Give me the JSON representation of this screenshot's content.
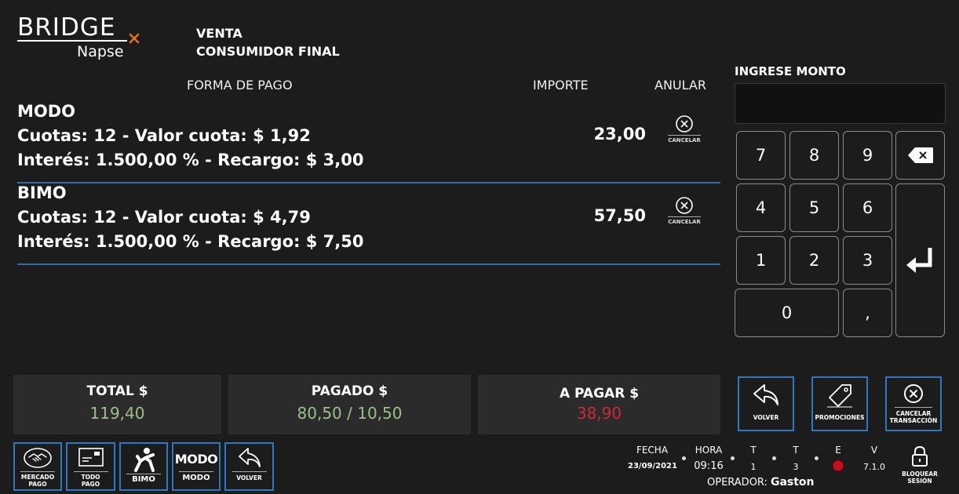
{
  "brand": {
    "name": "BRIDGE",
    "sub": "Napse",
    "accent": "#e8701a"
  },
  "header": {
    "line1": "VENTA",
    "line2": "CONSUMIDOR FINAL"
  },
  "columns": {
    "forma": "FORMA DE PAGO",
    "importe": "IMPORTE",
    "anular": "ANULAR"
  },
  "payments": [
    {
      "name": "MODO",
      "cuotas": "Cuotas: 12 - Valor cuota: $ 1,92",
      "interes": "Interés: 1.500,00 % - Recargo: $ 3,00",
      "importe": "23,00",
      "cancel_label": "CANCELAR"
    },
    {
      "name": "BIMO",
      "cuotas": "Cuotas: 12 - Valor cuota: $ 4,79",
      "interes": "Interés: 1.500,00 % - Recargo: $ 7,50",
      "importe": "57,50",
      "cancel_label": "CANCELAR"
    }
  ],
  "monto": {
    "label": "INGRESE MONTO",
    "value": ""
  },
  "keypad": {
    "k7": "7",
    "k8": "8",
    "k9": "9",
    "k4": "4",
    "k5": "5",
    "k6": "6",
    "k1": "1",
    "k2": "2",
    "k3": "3",
    "k0": "0",
    "comma": ","
  },
  "totals": {
    "total_label": "TOTAL $",
    "total_value": "119,40",
    "pagado_label": "PAGADO $",
    "pagado_value": "80,50 / 10,50",
    "apagar_label": "A PAGAR $",
    "apagar_value": "38,90"
  },
  "colors": {
    "green": "#9fbf8a",
    "red": "#d0283a",
    "blue_border": "#2e78c2",
    "divider": "#2e6fa8"
  },
  "actions": {
    "volver": "VOLVER",
    "promociones": "PROMOCIONES",
    "cancelar_line1": "CANCELAR",
    "cancelar_line2": "TRANSACCIÓN"
  },
  "pay_methods": {
    "mercado_line1": "MERCADO",
    "mercado_line2": "PAGO",
    "todo_line1": "TODO",
    "todo_line2": "PAGO",
    "bimo": "BIMO",
    "modo_logo": "MODO",
    "modo": "MODO",
    "volver": "VOLVER"
  },
  "status": {
    "fecha_label": "FECHA",
    "fecha": "23/09/2021",
    "hora_label": "HORA",
    "hora": "09:16",
    "t1_label": "T",
    "t1": "1",
    "t2_label": "T",
    "t2": "3",
    "e_label": "E",
    "v_label": "V",
    "v": "7.1.0",
    "operador_label": "OPERADOR:",
    "operador": "Gaston",
    "bloquear_line1": "BLOQUEAR",
    "bloquear_line2": "SESIÓN"
  }
}
